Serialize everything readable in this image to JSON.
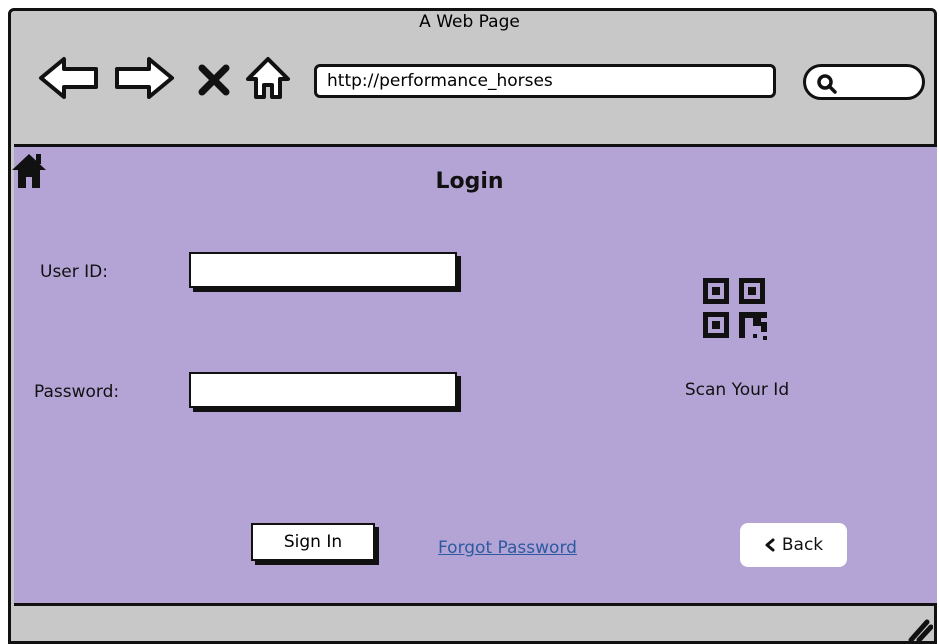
{
  "browser": {
    "title": "A Web Page",
    "url": "http://performance_horses"
  },
  "login": {
    "title": "Login",
    "user_label": "User ID:",
    "password_label": "Password:",
    "scan_label": "Scan Your Id",
    "signin_label": "Sign In",
    "forgot_label": "Forgot Password",
    "back_label": "Back"
  },
  "colors": {
    "chrome": "#c8c8c8",
    "content_bg": "#b4a4d6",
    "link": "#2c5aa0"
  },
  "icons": [
    "back-arrow-icon",
    "forward-arrow-icon",
    "close-icon",
    "home-outline-icon",
    "search-icon",
    "home-icon",
    "qr-code-icon",
    "chevron-left-icon",
    "resize-grip-icon"
  ]
}
